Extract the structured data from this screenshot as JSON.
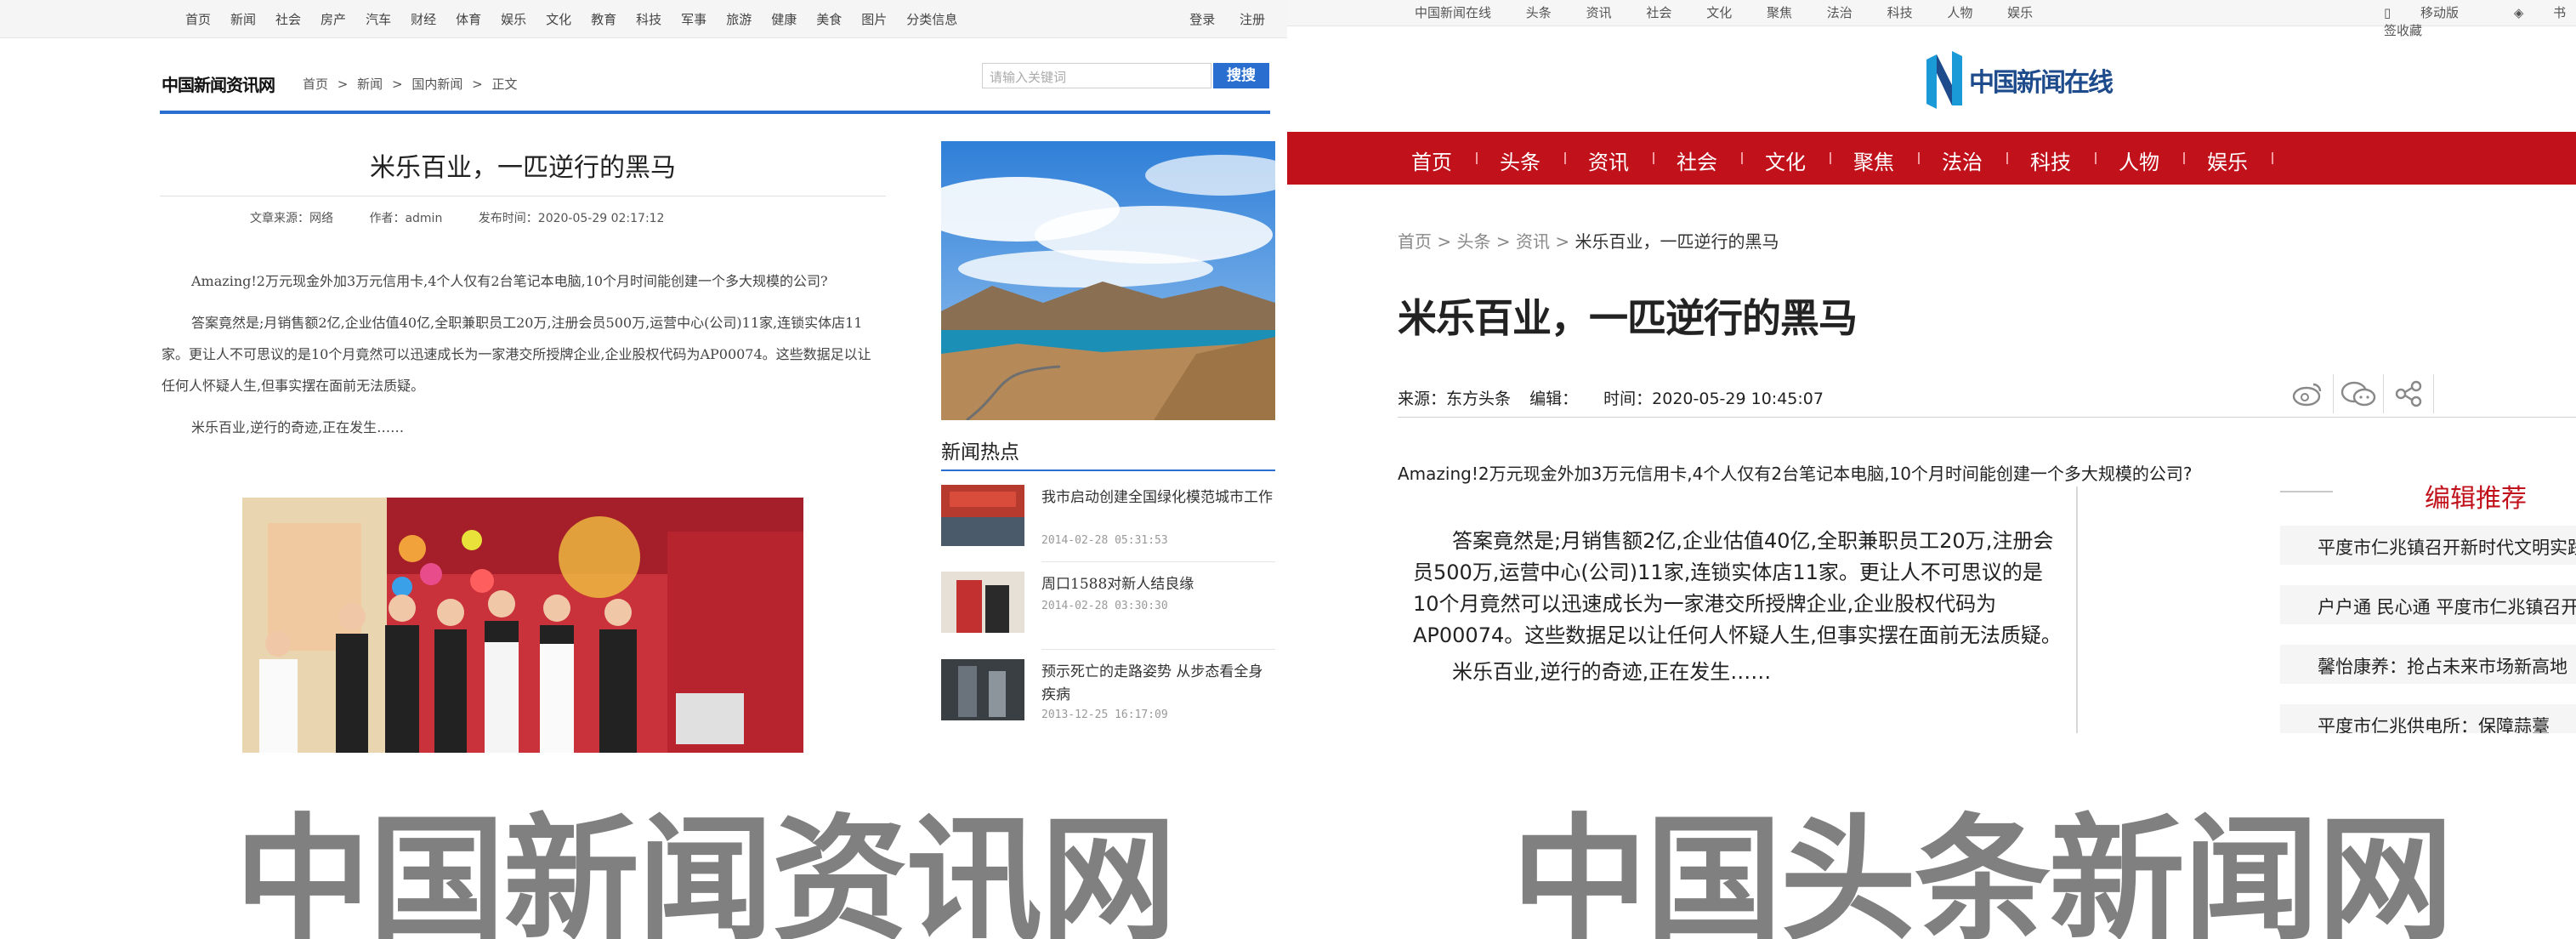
{
  "left": {
    "topnav": {
      "items": [
        "首页",
        "新闻",
        "社会",
        "房产",
        "汽车",
        "财经",
        "体育",
        "娱乐",
        "文化",
        "教育",
        "科技",
        "军事",
        "旅游",
        "健康",
        "美食",
        "图片",
        "分类信息"
      ],
      "login": "登录",
      "register": "注册"
    },
    "logo": "中国新闻资讯网",
    "breadcrumb": [
      "首页",
      "新闻",
      "国内新闻",
      "正文"
    ],
    "breadcrumb_sep": ">",
    "search": {
      "placeholder": "请输入关键词",
      "button": "搜搜"
    },
    "article": {
      "title": "米乐百业，一匹逆行的黑马",
      "source": "文章来源：网络",
      "author": "作者：admin",
      "published": "发布时间：2020-05-29 02:17:12",
      "paragraphs": [
        "Amazing!2万元现金外加3万元信用卡,4个人仅有2台笔记本电脑,10个月时间能创建一个多大规模的公司?",
        "答案竟然是;月销售额2亿,企业估值40亿,全职兼职员工20万,注册会员500万,运营中心(公司)11家,连锁实体店11家。更让人不可思议的是10个月竟然可以迅速成长为一家港交所授牌企业,企业股权代码为AP00074。这些数据足以让任何人怀疑人生,但事实摆在面前无法质疑。",
        "米乐百业,逆行的奇迹,正在发生……"
      ]
    },
    "sidebar": {
      "title": "新闻热点",
      "news": [
        {
          "title": "我市启动创建全国绿化模范城市工作",
          "date": "2014-02-28 05:31:53"
        },
        {
          "title": "周口1588对新人结良缘",
          "date": "2014-02-28 03:30:30"
        },
        {
          "title": "预示死亡的走路姿势 从步态看全身疾病",
          "date": "2013-12-25 16:17:09"
        }
      ]
    },
    "caption": "中国新闻资讯网"
  },
  "right": {
    "topnav": {
      "items": [
        "中国新闻在线",
        "头条",
        "资讯",
        "社会",
        "文化",
        "聚焦",
        "法治",
        "科技",
        "人物",
        "娱乐"
      ],
      "mobile": "移动版",
      "bookmark": "书签收藏"
    },
    "logo": "中国新闻在线",
    "nav": [
      "首页",
      "头条",
      "资讯",
      "社会",
      "文化",
      "聚焦",
      "法治",
      "科技",
      "人物",
      "娱乐"
    ],
    "breadcrumb": {
      "items": [
        "首页",
        "头条",
        "资讯"
      ],
      "sep": ">",
      "current": "米乐百业，一匹逆行的黑马"
    },
    "article": {
      "title": "米乐百业，一匹逆行的黑马",
      "source_label": "来源：",
      "source": "东方头条",
      "editor_label": "编辑：",
      "time_label": "时间：",
      "time": "2020-05-29 10:45:07",
      "lead": "Amazing!2万元现金外加3万元信用卡,4个人仅有2台笔记本电脑,10个月时间能创建一个多大规模的公司?",
      "paragraphs": [
        "答案竟然是;月销售额2亿,企业估值40亿,全职兼职员工20万,注册会员500万,运营中心(公司)11家,连锁实体店11家。更让人不可思议的是10个月竟然可以迅速成长为一家港交所授牌企业,企业股权代码为AP00074。这些数据足以让任何人怀疑人生,但事实摆在面前无法质疑。",
        "米乐百业,逆行的奇迹,正在发生……"
      ]
    },
    "recommend": {
      "title": "编辑推荐",
      "items": [
        "平度市仁兆镇召开新时代文明实践",
        "户户通 民心通 平度市仁兆镇召开",
        "馨怡康养：抢占未来市场新高地",
        "平度市仁兆供电所：保障蒜薹"
      ]
    },
    "caption": "中国头条新闻网"
  },
  "colors": {
    "left_accent": "#2a6fd0",
    "right_nav": "#c1121b",
    "caption": "#808080"
  }
}
